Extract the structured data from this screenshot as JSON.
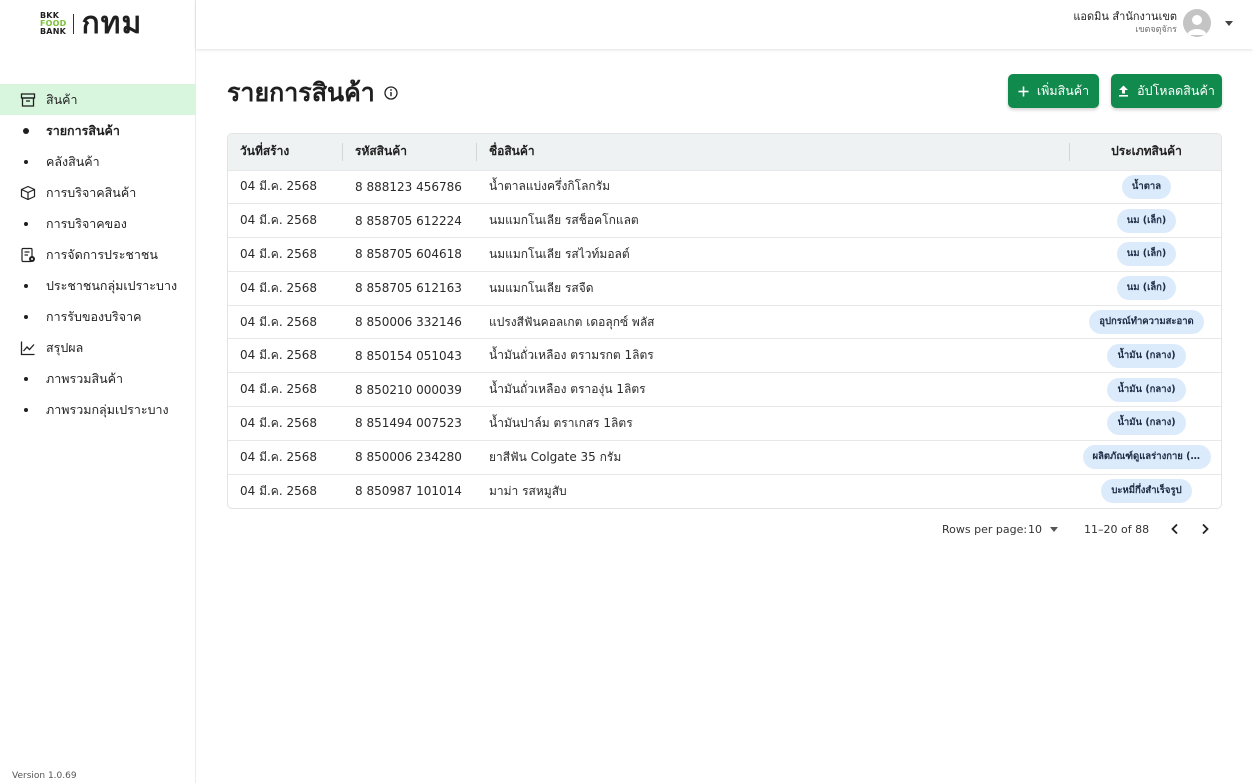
{
  "brand": {
    "logo_line1": "BKK",
    "logo_line2": "FOOD",
    "logo_line3": "BANK",
    "logo_thai": "กทม"
  },
  "sidebar": {
    "sections": [
      {
        "label": "สินค้า",
        "icon": "archive-box-icon",
        "active": true,
        "items": [
          {
            "label": "รายการสินค้า",
            "current": true
          },
          {
            "label": "คลังสินค้า",
            "current": false
          }
        ]
      },
      {
        "label": "การบริจาคสินค้า",
        "icon": "package-icon",
        "active": false,
        "items": [
          {
            "label": "การบริจาคของ",
            "current": false
          }
        ]
      },
      {
        "label": "การจัดการประชาชน",
        "icon": "document-settings-icon",
        "active": false,
        "items": [
          {
            "label": "ประชาชนกลุ่มเปราะบาง",
            "current": false
          },
          {
            "label": "การรับของบริจาค",
            "current": false
          }
        ]
      },
      {
        "label": "สรุปผล",
        "icon": "line-chart-icon",
        "active": false,
        "items": [
          {
            "label": "ภาพรวมสินค้า",
            "current": false
          },
          {
            "label": "ภาพรวมกลุ่มเปราะบาง",
            "current": false
          }
        ]
      }
    ],
    "version": "Version 1.0.69"
  },
  "header": {
    "user_name": "แอดมิน สำนักงานเขต",
    "user_district": "เขตจตุจักร"
  },
  "main": {
    "title": "รายการสินค้า",
    "add_button": "เพิ่มสินค้า",
    "upload_button": "อัปโหลดสินค้า"
  },
  "table": {
    "columns": [
      "วันที่สร้าง",
      "รหัสสินค้า",
      "ชื่อสินค้า",
      "ประเภทสินค้า"
    ],
    "rows": [
      {
        "date": "04 มี.ค. 2568",
        "code": "8 888123 456786",
        "name": "น้ำตาลแบ่งครึ่งกิโลกรัม",
        "category": "น้ำตาล"
      },
      {
        "date": "04 มี.ค. 2568",
        "code": "8 858705 612224",
        "name": "นมแมกโนเลีย รสช็อคโกแลต",
        "category": "นม (เล็ก)"
      },
      {
        "date": "04 มี.ค. 2568",
        "code": "8 858705 604618",
        "name": "นมแมกโนเลีย รสไวท์มอลต์",
        "category": "นม (เล็ก)"
      },
      {
        "date": "04 มี.ค. 2568",
        "code": "8 858705 612163",
        "name": "นมแมกโนเลีย รสจืด",
        "category": "นม (เล็ก)"
      },
      {
        "date": "04 มี.ค. 2568",
        "code": "8 850006 332146",
        "name": "แปรงสีฟันคอลเกต เดอลุกซ์ พลัส",
        "category": "อุปกรณ์ทำความสะอาด"
      },
      {
        "date": "04 มี.ค. 2568",
        "code": "8 850154 051043",
        "name": "น้ำมันถั่วเหลือง ตรามรกต 1ลิตร",
        "category": "น้ำมัน (กลาง)"
      },
      {
        "date": "04 มี.ค. 2568",
        "code": "8 850210 000039",
        "name": "น้ำมันถั่วเหลือง ตราองุ่น 1ลิตร",
        "category": "น้ำมัน (กลาง)"
      },
      {
        "date": "04 มี.ค. 2568",
        "code": "8 851494 007523",
        "name": "น้ำมันปาล์ม ตราเกสร 1ลิตร",
        "category": "น้ำมัน (กลาง)"
      },
      {
        "date": "04 มี.ค. 2568",
        "code": "8 850006 234280",
        "name": "ยาสีฟัน Colgate 35 กรัม",
        "category": "ผลิตภัณฑ์ดูแลร่างกาย (เ..."
      },
      {
        "date": "04 มี.ค. 2568",
        "code": "8 850987 101014",
        "name": "มาม่า รสหมูสับ",
        "category": "บะหมี่กึ่งสำเร็จรูป"
      }
    ]
  },
  "pagination": {
    "rows_per_page_label": "Rows per page:",
    "rows_per_page": "10",
    "range": "11–20 of 88"
  },
  "colors": {
    "primary_green": "#108a4d",
    "active_nav_bg": "#d8f5dd",
    "chip_bg": "#dcebfb",
    "table_header_bg": "#eef2f2"
  }
}
